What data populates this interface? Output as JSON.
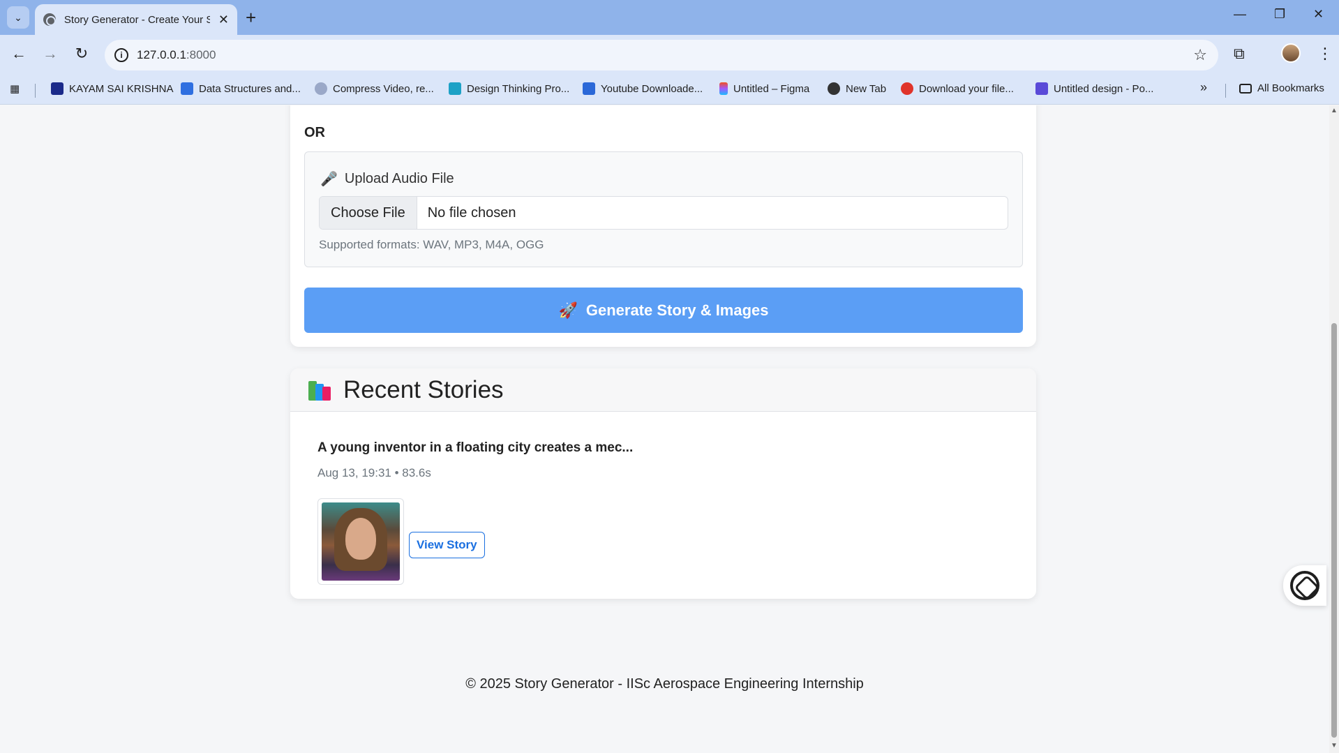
{
  "browser": {
    "tab_title": "Story Generator - Create Your S",
    "url_host": "127.0.0.1",
    "url_port": ":8000",
    "bookmarks": [
      "KAYAM SAI KRISHNA",
      "Data Structures and...",
      "Compress Video, re...",
      "Design Thinking Pro...",
      "Youtube Downloade...",
      "Untitled – Figma",
      "New Tab",
      "Download your file...",
      "Untitled design - Po..."
    ],
    "all_bookmarks": "All Bookmarks",
    "overflow_chevron": "»"
  },
  "form": {
    "or_label": "OR",
    "upload_label": "Upload Audio File",
    "file_button": "Choose File",
    "file_status": "No file chosen",
    "formats": "Supported formats: WAV, MP3, M4A, OGG",
    "generate_button": "Generate Story & Images"
  },
  "recent": {
    "heading": "Recent Stories",
    "stories": [
      {
        "title": "A young inventor in a floating city creates a mec...",
        "meta": "Aug 13, 19:31 • 83.6s",
        "view_label": "View Story"
      }
    ]
  },
  "footer": {
    "text": "© 2025 Story Generator - IISc Aerospace Engineering Internship"
  },
  "icons": {
    "mic": "microphone-icon",
    "rocket": "rocket-icon",
    "books": "books-icon",
    "assistant": "ai-assistant-icon"
  },
  "colors": {
    "accent": "#5b9ef5",
    "link": "#1a6fe0",
    "tabbar": "#8fb3ea",
    "toolbar": "#dbe6f9"
  }
}
